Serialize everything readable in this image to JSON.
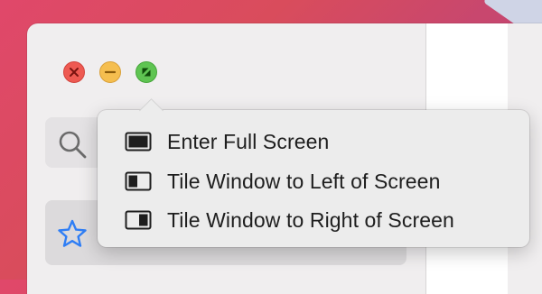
{
  "window": {
    "traffic_lights": {
      "close_icon": "close-x-icon",
      "minimize_icon": "minus-icon",
      "zoom_icon": "fullscreen-arrows-icon"
    },
    "sidebar": {
      "search_icon": "magnifying-glass-icon",
      "favorites_icon": "star-icon"
    }
  },
  "zoom_menu": {
    "items": [
      {
        "label": "Enter Full Screen",
        "icon": "full-screen-icon"
      },
      {
        "label": "Tile Window to Left of Screen",
        "icon": "tile-left-icon"
      },
      {
        "label": "Tile Window to Right of Screen",
        "icon": "tile-right-icon"
      }
    ]
  },
  "colors": {
    "close": "#ee5a52",
    "minimize": "#f5be4f",
    "zoom": "#5fc452",
    "accent_blue": "#2f7ef5",
    "menu_bg": "#ececec"
  }
}
